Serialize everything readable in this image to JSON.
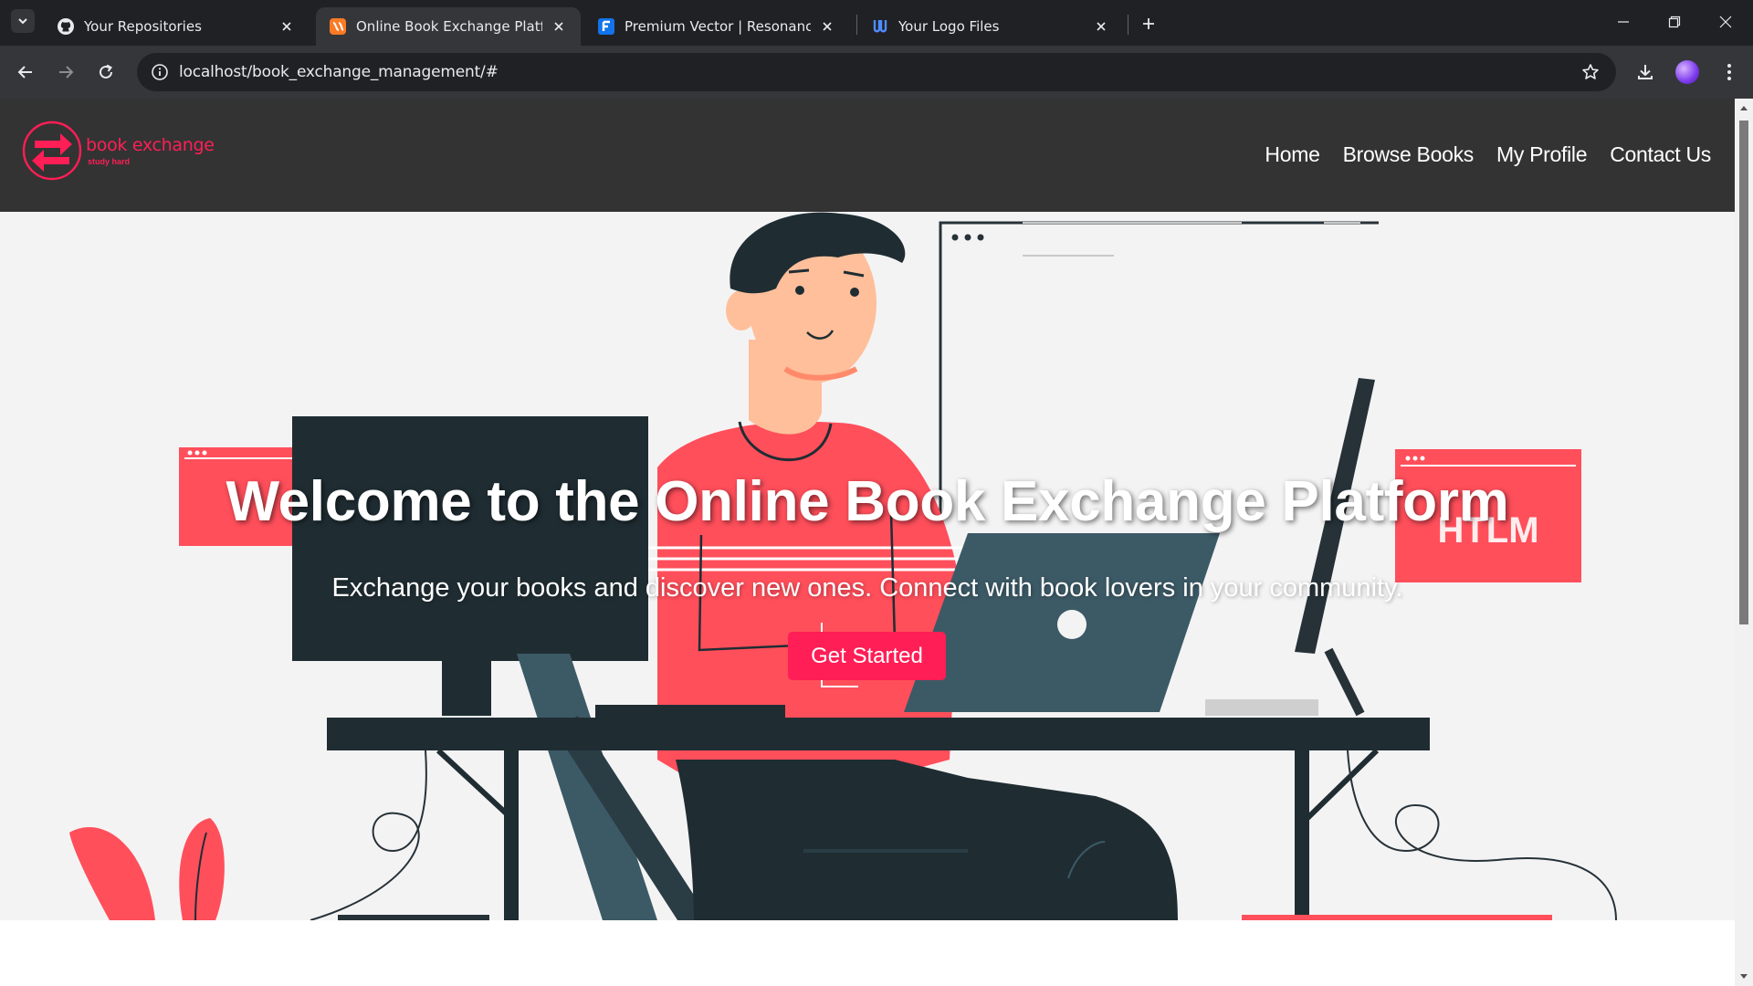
{
  "browser": {
    "tabs": [
      {
        "title": "Your Repositories",
        "icon": "github-icon",
        "active": false
      },
      {
        "title": "Online Book Exchange Platform",
        "icon": "xampp-icon",
        "active": true
      },
      {
        "title": "Premium Vector | Resonance sc",
        "icon": "freepik-icon",
        "active": false
      },
      {
        "title": "Your Logo Files",
        "icon": "logo-files-icon",
        "active": false
      }
    ],
    "url": "localhost/book_exchange_management/#"
  },
  "site": {
    "logo": {
      "name": "book exchange",
      "tagline": "study hard"
    },
    "nav": [
      "Home",
      "Browse Books",
      "My Profile",
      "Contact Us"
    ],
    "hero": {
      "title": "Welcome to the Online Book Exchange Platform",
      "subtitle": "Exchange your books and discover new ones. Connect with book lovers in your community.",
      "cta": "Get Started",
      "art_label": "HTLM"
    },
    "colors": {
      "accent": "#ff1e56",
      "header_bg": "#333333",
      "hero_bg": "#f4f3f4"
    }
  }
}
